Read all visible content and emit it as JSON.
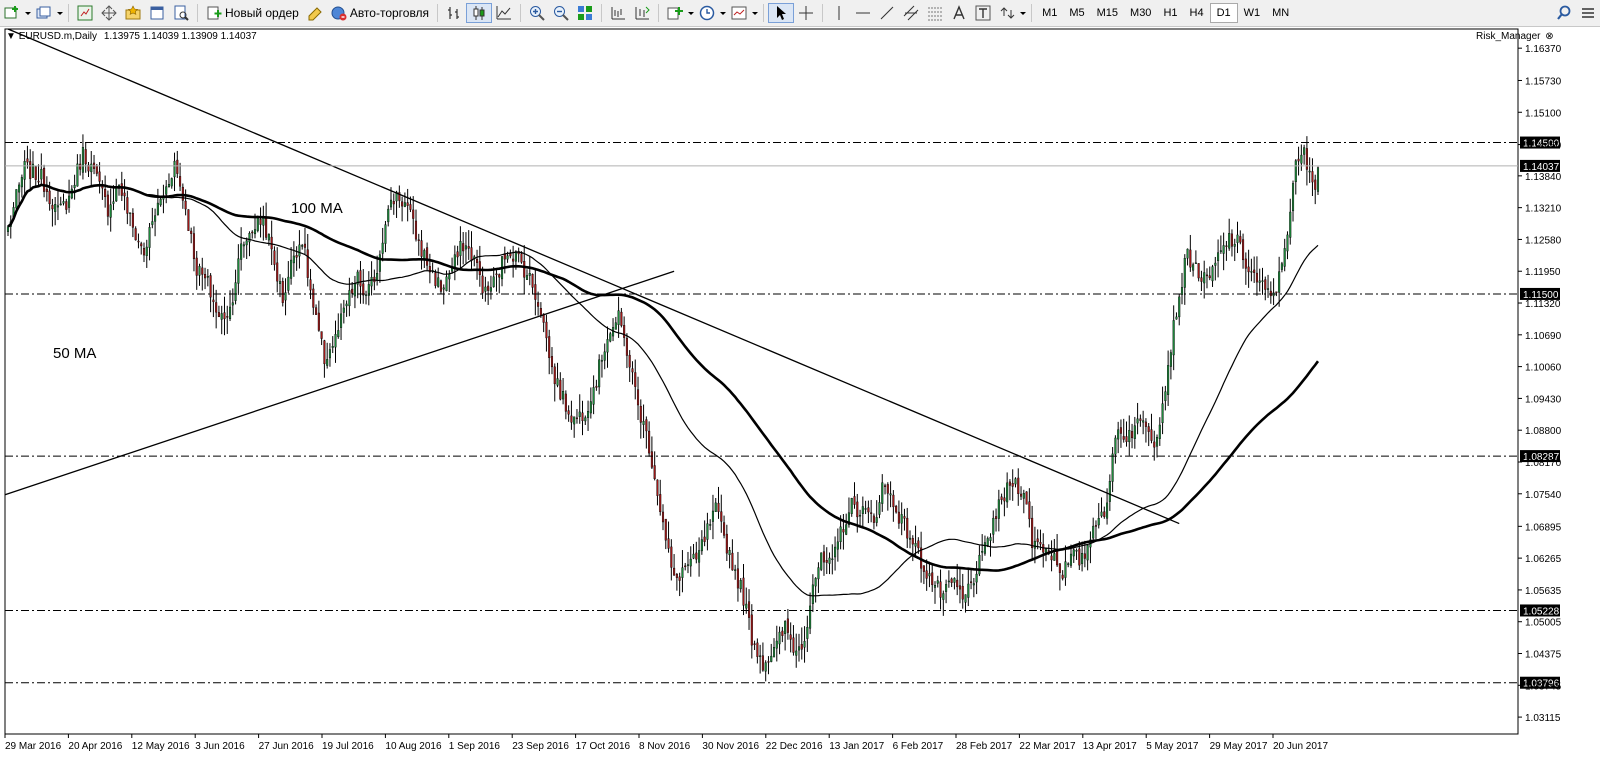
{
  "toolbar": {
    "new_order_label": "Новый ордер",
    "auto_trading_label": "Авто-торговля",
    "timeframes": [
      "M1",
      "M5",
      "M15",
      "M30",
      "H1",
      "H4",
      "D1",
      "W1",
      "MN"
    ],
    "active_timeframe": "D1"
  },
  "chart_header": {
    "symbol": "EURUSD.m,Daily",
    "ohlc": "1.13975 1.14039 1.13909 1.14037",
    "indicator": "Risk_Manager"
  },
  "chart_data": {
    "type": "candlestick",
    "ylim": [
      1.0278,
      1.1675
    ],
    "y_ticks": [
      "1.16370",
      "1.15730",
      "1.15100",
      "1.14460",
      "1.13840",
      "1.13210",
      "1.12580",
      "1.11950",
      "1.11320",
      "1.10690",
      "1.10060",
      "1.09430",
      "1.08800",
      "1.08170",
      "1.07540",
      "1.06895",
      "1.06265",
      "1.05635",
      "1.05005",
      "1.04375",
      "1.03745",
      "1.03115"
    ],
    "x_labels": [
      "29 Mar 2016",
      "20 Apr 2016",
      "12 May 2016",
      "3 Jun 2016",
      "27 Jun 2016",
      "19 Jul 2016",
      "10 Aug 2016",
      "1 Sep 2016",
      "23 Sep 2016",
      "17 Oct 2016",
      "8 Nov 2016",
      "30 Nov 2016",
      "22 Dec 2016",
      "13 Jan 2017",
      "6 Feb 2017",
      "28 Feb 2017",
      "22 Mar 2017",
      "13 Apr 2017",
      "5 May 2017",
      "29 May 2017",
      "20 Jun 2017"
    ],
    "horizontal_levels": [
      {
        "value": 1.145,
        "label": "1.14500"
      },
      {
        "value": 1.115,
        "label": "1.11500"
      },
      {
        "value": 1.08287,
        "label": "1.08287"
      },
      {
        "value": 1.05228,
        "label": "1.05228"
      },
      {
        "value": 1.03796,
        "label": "1.03796"
      }
    ],
    "current_price": {
      "value": 1.14037,
      "label": "1.14037"
    },
    "annotations": [
      "100 MA",
      "50 MA"
    ],
    "anchors": [
      [
        0,
        1.128
      ],
      [
        6,
        1.14
      ],
      [
        12,
        1.138
      ],
      [
        18,
        1.131
      ],
      [
        22,
        1.134
      ],
      [
        27,
        1.143
      ],
      [
        31,
        1.139
      ],
      [
        36,
        1.132
      ],
      [
        40,
        1.137
      ],
      [
        45,
        1.128
      ],
      [
        49,
        1.123
      ],
      [
        53,
        1.131
      ],
      [
        57,
        1.136
      ],
      [
        60,
        1.141
      ],
      [
        64,
        1.132
      ],
      [
        68,
        1.12
      ],
      [
        72,
        1.117
      ],
      [
        76,
        1.11
      ],
      [
        80,
        1.112
      ],
      [
        84,
        1.124
      ],
      [
        88,
        1.128
      ],
      [
        92,
        1.13
      ],
      [
        96,
        1.121
      ],
      [
        99,
        1.114
      ],
      [
        103,
        1.123
      ],
      [
        106,
        1.126
      ],
      [
        110,
        1.112
      ],
      [
        114,
        1.102
      ],
      [
        118,
        1.106
      ],
      [
        122,
        1.113
      ],
      [
        126,
        1.118
      ],
      [
        129,
        1.114
      ],
      [
        133,
        1.12
      ],
      [
        136,
        1.13
      ],
      [
        140,
        1.135
      ],
      [
        144,
        1.132
      ],
      [
        148,
        1.125
      ],
      [
        152,
        1.12
      ],
      [
        156,
        1.116
      ],
      [
        160,
        1.12
      ],
      [
        164,
        1.125
      ],
      [
        168,
        1.122
      ],
      [
        172,
        1.115
      ],
      [
        176,
        1.118
      ],
      [
        180,
        1.124
      ],
      [
        184,
        1.122
      ],
      [
        188,
        1.118
      ],
      [
        192,
        1.112
      ],
      [
        196,
        1.1
      ],
      [
        200,
        1.094
      ],
      [
        204,
        1.09
      ],
      [
        208,
        1.092
      ],
      [
        212,
        1.098
      ],
      [
        216,
        1.107
      ],
      [
        220,
        1.11
      ],
      [
        223,
        1.104
      ],
      [
        227,
        1.093
      ],
      [
        231,
        1.085
      ],
      [
        234,
        1.076
      ],
      [
        237,
        1.066
      ],
      [
        240,
        1.058
      ],
      [
        244,
        1.061
      ],
      [
        248,
        1.062
      ],
      [
        252,
        1.068
      ],
      [
        255,
        1.072
      ],
      [
        258,
        1.067
      ],
      [
        262,
        1.06
      ],
      [
        265,
        1.055
      ],
      [
        268,
        1.047
      ],
      [
        272,
        1.042
      ],
      [
        276,
        1.044
      ],
      [
        280,
        1.049
      ],
      [
        284,
        1.044
      ],
      [
        287,
        1.047
      ],
      [
        290,
        1.058
      ],
      [
        293,
        1.062
      ],
      [
        297,
        1.061
      ],
      [
        300,
        1.068
      ],
      [
        304,
        1.073
      ],
      [
        308,
        1.072
      ],
      [
        312,
        1.07
      ],
      [
        315,
        1.077
      ],
      [
        318,
        1.075
      ],
      [
        322,
        1.07
      ],
      [
        326,
        1.066
      ],
      [
        329,
        1.062
      ],
      [
        333,
        1.058
      ],
      [
        337,
        1.055
      ],
      [
        341,
        1.058
      ],
      [
        344,
        1.054
      ],
      [
        348,
        1.059
      ],
      [
        352,
        1.064
      ],
      [
        355,
        1.07
      ],
      [
        359,
        1.075
      ],
      [
        362,
        1.078
      ],
      [
        366,
        1.076
      ],
      [
        369,
        1.066
      ],
      [
        373,
        1.065
      ],
      [
        377,
        1.063
      ],
      [
        380,
        1.06
      ],
      [
        384,
        1.063
      ],
      [
        387,
        1.062
      ],
      [
        390,
        1.067
      ],
      [
        393,
        1.072
      ],
      [
        396,
        1.072
      ],
      [
        399,
        1.088
      ],
      [
        403,
        1.087
      ],
      [
        407,
        1.089
      ],
      [
        410,
        1.09
      ],
      [
        413,
        1.086
      ],
      [
        416,
        1.093
      ],
      [
        419,
        1.105
      ],
      [
        422,
        1.115
      ],
      [
        425,
        1.123
      ],
      [
        428,
        1.12
      ],
      [
        432,
        1.117
      ],
      [
        436,
        1.122
      ],
      [
        440,
        1.126
      ],
      [
        443,
        1.125
      ],
      [
        447,
        1.12
      ],
      [
        451,
        1.117
      ],
      [
        455,
        1.114
      ],
      [
        458,
        1.118
      ],
      [
        461,
        1.128
      ],
      [
        464,
        1.14
      ],
      [
        467,
        1.143
      ],
      [
        469,
        1.138
      ],
      [
        471,
        1.136
      ],
      [
        472,
        1.14
      ]
    ],
    "n_bars": 473
  }
}
